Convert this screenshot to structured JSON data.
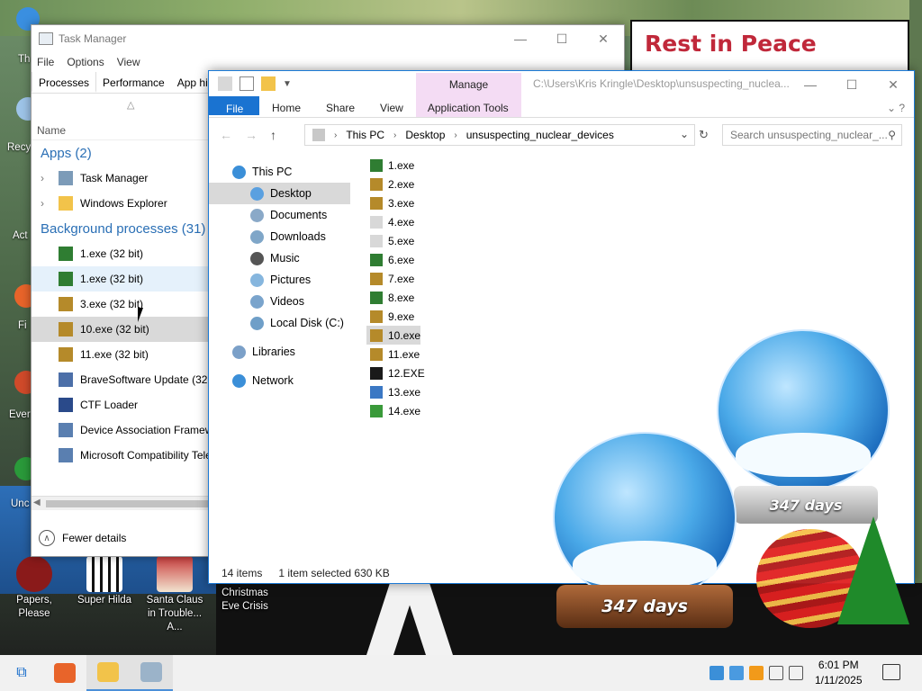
{
  "desktop": {
    "icons": [
      {
        "label": "Papers, Please",
        "icon": "papers-please-icon"
      },
      {
        "label": "Super Hilda",
        "icon": "super-hilda-icon"
      },
      {
        "label": "Santa Claus in Trouble... A...",
        "icon": "santa-claus-icon"
      },
      {
        "label": "Christmas Eve Crisis",
        "icon": "christmas-eve-crisis-icon"
      }
    ],
    "edge_labels": [
      "Th",
      "Recy",
      "Act",
      "Fi",
      "Ever",
      "Unc"
    ],
    "banner_text": "Rest in Peace",
    "globe_days_left": "347 days",
    "globe_days_right": "347 days"
  },
  "task_manager": {
    "title": "Task Manager",
    "window_controls": [
      "—",
      "☐",
      "✕"
    ],
    "menu": [
      "File",
      "Options",
      "View"
    ],
    "tabs": [
      "Processes",
      "Performance",
      "App histo"
    ],
    "column_name": "Name",
    "groups": {
      "apps": "Apps (2)",
      "background": "Background processes (31)"
    },
    "apps": [
      {
        "name": "Task Manager",
        "icon": "task-manager-icon"
      },
      {
        "name": "Windows Explorer",
        "icon": "folder-icon"
      }
    ],
    "background": [
      {
        "name": "1.exe (32 bit)",
        "icon": "green-tree-icon",
        "state": ""
      },
      {
        "name": "1.exe (32 bit)",
        "icon": "green-tree-icon",
        "state": "hover"
      },
      {
        "name": "3.exe (32 bit)",
        "icon": "gold-tree-icon",
        "state": ""
      },
      {
        "name": "10.exe (32 bit)",
        "icon": "gold-tree-icon",
        "state": "selected"
      },
      {
        "name": "11.exe (32 bit)",
        "icon": "gold-tree-icon",
        "state": ""
      },
      {
        "name": "BraveSoftware Update (32 bit)",
        "icon": "brave-update-icon",
        "state": ""
      },
      {
        "name": "CTF Loader",
        "icon": "ctf-loader-icon",
        "state": ""
      },
      {
        "name": "Device Association Framewo",
        "icon": "service-icon",
        "state": ""
      },
      {
        "name": "Microsoft Compatibility Tele",
        "icon": "service-icon",
        "state": ""
      }
    ],
    "footer": "Fewer details"
  },
  "explorer": {
    "title_path": "C:\\Users\\Kris Kringle\\Desktop\\unsuspecting_nuclea...",
    "manage_tab": "Manage",
    "window_controls": [
      "—",
      "☐",
      "✕"
    ],
    "ribbon": [
      "File",
      "Home",
      "Share",
      "View",
      "Application Tools"
    ],
    "breadcrumb": [
      "This PC",
      "Desktop",
      "unsuspecting_nuclear_devices"
    ],
    "search_placeholder": "Search unsuspecting_nuclear_...",
    "tree": [
      {
        "label": "This PC",
        "level": "top",
        "icon": "computer-icon",
        "color": "#3b8fd8"
      },
      {
        "label": "Desktop",
        "level": "child",
        "icon": "desktop-icon",
        "color": "#5aa0e0",
        "selected": true
      },
      {
        "label": "Documents",
        "level": "child",
        "icon": "documents-icon",
        "color": "#8aa9c8"
      },
      {
        "label": "Downloads",
        "level": "child",
        "icon": "downloads-icon",
        "color": "#7fa6c8"
      },
      {
        "label": "Music",
        "level": "child",
        "icon": "music-icon",
        "color": "#555555"
      },
      {
        "label": "Pictures",
        "level": "child",
        "icon": "pictures-icon",
        "color": "#86b6de"
      },
      {
        "label": "Videos",
        "level": "child",
        "icon": "videos-icon",
        "color": "#7aa4cc"
      },
      {
        "label": "Local Disk (C:)",
        "level": "child",
        "icon": "drive-icon",
        "color": "#6f9fc8"
      },
      {
        "label": "Libraries",
        "level": "top",
        "icon": "libraries-icon",
        "color": "#7ba0c8"
      },
      {
        "label": "Network",
        "level": "top",
        "icon": "network-icon",
        "color": "#3b8fd8"
      }
    ],
    "files": [
      {
        "name": "1.exe",
        "icon": "green-tree-icon",
        "color": "#2f7d32"
      },
      {
        "name": "2.exe",
        "icon": "gold-tree-icon",
        "color": "#b58a2a"
      },
      {
        "name": "3.exe",
        "icon": "gold-tree-icon",
        "color": "#b58a2a"
      },
      {
        "name": "4.exe",
        "icon": "snowflake-icon",
        "color": "#d8d8d8"
      },
      {
        "name": "5.exe",
        "icon": "snowflake-icon",
        "color": "#d8d8d8"
      },
      {
        "name": "6.exe",
        "icon": "green-tree-icon",
        "color": "#2f7d32"
      },
      {
        "name": "7.exe",
        "icon": "gold-tree-icon",
        "color": "#b58a2a"
      },
      {
        "name": "8.exe",
        "icon": "green-tree-icon",
        "color": "#2f7d32"
      },
      {
        "name": "9.exe",
        "icon": "gold-tree-icon",
        "color": "#b58a2a"
      },
      {
        "name": "10.exe",
        "icon": "gold-tree-icon",
        "color": "#b58a2a",
        "selected": true
      },
      {
        "name": "11.exe",
        "icon": "gold-tree-icon",
        "color": "#b58a2a"
      },
      {
        "name": "12.EXE",
        "icon": "pixel-game-icon",
        "color": "#1a1a1a"
      },
      {
        "name": "13.exe",
        "icon": "window-app-icon",
        "color": "#3b78c4"
      },
      {
        "name": "14.exe",
        "icon": "green-arrow-icon",
        "color": "#3a9a3a"
      }
    ],
    "status": {
      "count": "14 items",
      "selection": "1 item selected  630 KB"
    }
  },
  "taskbar": {
    "apps": [
      {
        "icon": "firefox-icon",
        "color": "#e8642a",
        "active": false
      },
      {
        "icon": "file-explorer-icon",
        "color": "#f2c34a",
        "active": true
      },
      {
        "icon": "task-manager-icon",
        "color": "#9bb3c9",
        "active": true
      }
    ],
    "time": "6:01 PM",
    "date": "1/11/2025"
  }
}
